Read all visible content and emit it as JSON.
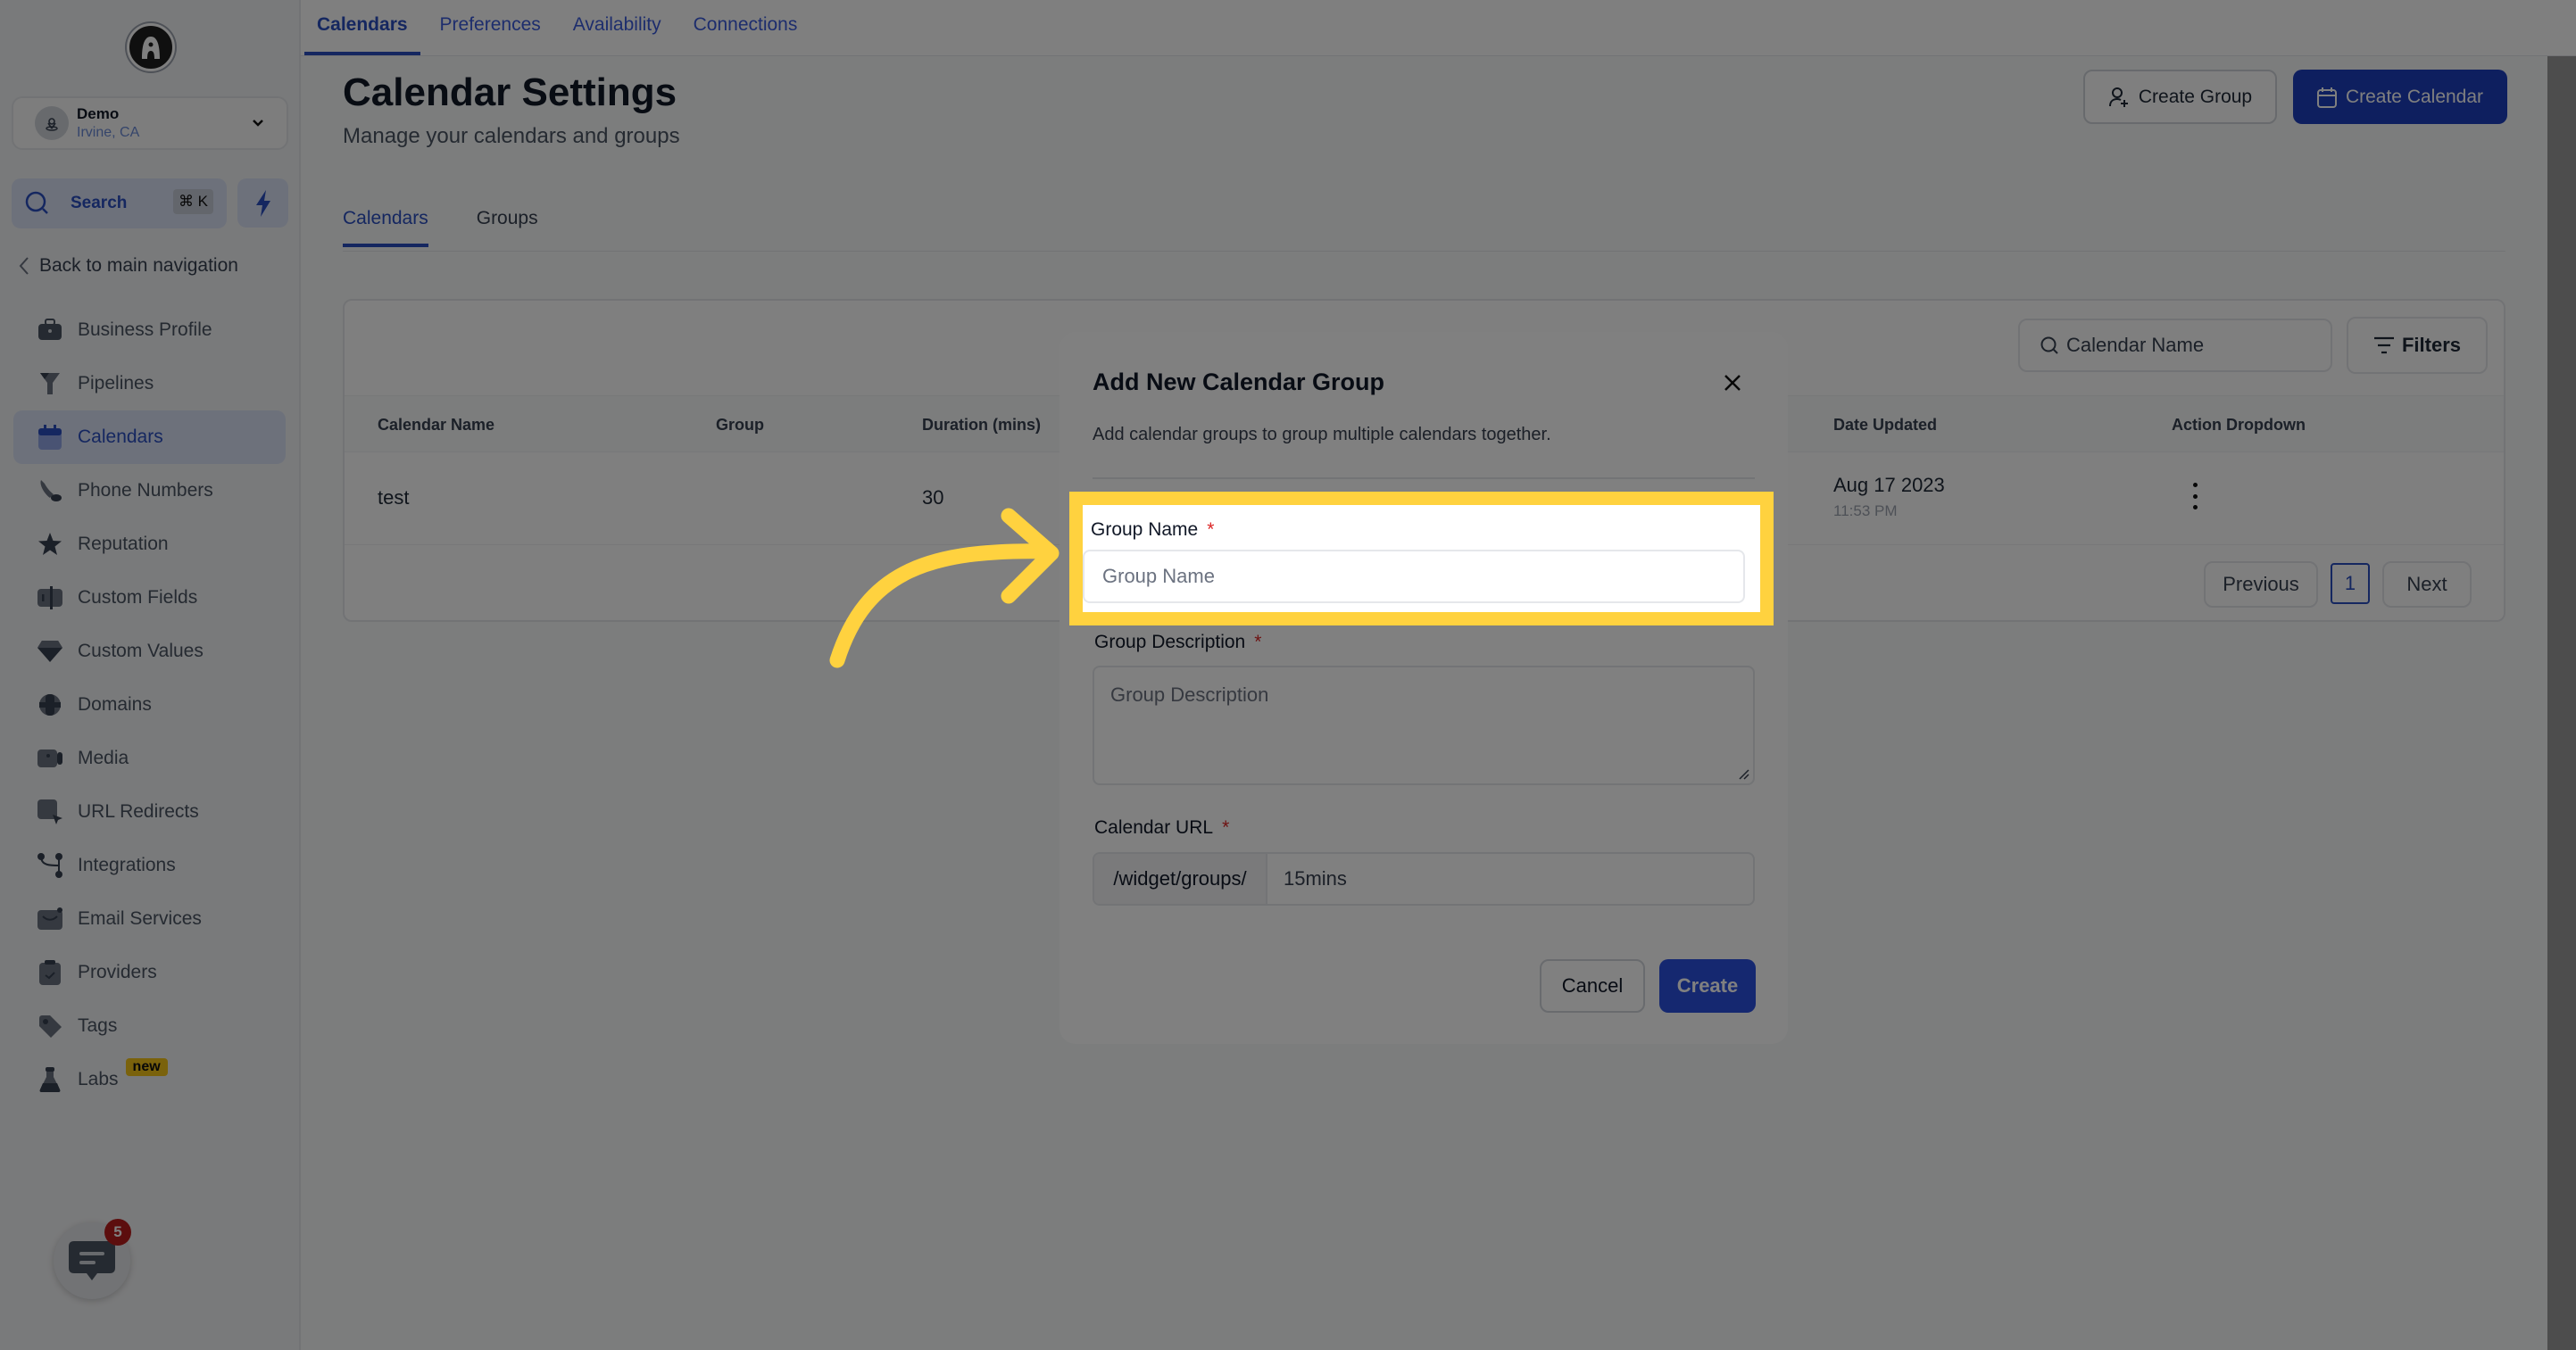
{
  "sidebar": {
    "account": {
      "name": "Demo",
      "location": "Irvine, CA"
    },
    "search": {
      "label": "Search",
      "shortcut": "⌘ K"
    },
    "back_label": "Back to main navigation",
    "items": [
      {
        "label": "Business Profile",
        "icon": "briefcase-icon",
        "active": false
      },
      {
        "label": "Pipelines",
        "icon": "funnel-icon",
        "active": false
      },
      {
        "label": "Calendars",
        "icon": "calendar-icon",
        "active": true
      },
      {
        "label": "Phone Numbers",
        "icon": "phone-icon",
        "active": false
      },
      {
        "label": "Reputation",
        "icon": "star-icon",
        "active": false
      },
      {
        "label": "Custom Fields",
        "icon": "field-icon",
        "active": false
      },
      {
        "label": "Custom Values",
        "icon": "gem-icon",
        "active": false
      },
      {
        "label": "Domains",
        "icon": "globe-icon",
        "active": false
      },
      {
        "label": "Media",
        "icon": "video-icon",
        "active": false
      },
      {
        "label": "URL Redirects",
        "icon": "cursor-icon",
        "active": false
      },
      {
        "label": "Integrations",
        "icon": "branch-icon",
        "active": false
      },
      {
        "label": "Email Services",
        "icon": "mail-icon",
        "active": false
      },
      {
        "label": "Providers",
        "icon": "clipboard-icon",
        "active": false
      },
      {
        "label": "Tags",
        "icon": "tag-icon",
        "active": false
      },
      {
        "label": "Labs",
        "icon": "flask-icon",
        "active": false,
        "badge": "new"
      }
    ],
    "chat_badge_count": "5"
  },
  "topnav": {
    "tabs": [
      {
        "label": "Calendars",
        "active": true
      },
      {
        "label": "Preferences",
        "active": false
      },
      {
        "label": "Availability",
        "active": false
      },
      {
        "label": "Connections",
        "active": false
      }
    ]
  },
  "page": {
    "title": "Calendar Settings",
    "subtitle": "Manage your calendars and groups",
    "create_group_label": "Create Group",
    "create_calendar_label": "Create Calendar",
    "subtabs": [
      {
        "label": "Calendars",
        "active": true
      },
      {
        "label": "Groups",
        "active": false
      }
    ]
  },
  "table": {
    "search_placeholder": "Calendar Name",
    "filters_label": "Filters",
    "columns": [
      "Calendar Name",
      "Group",
      "Duration (mins)",
      "Date Updated",
      "Action Dropdown"
    ],
    "rows": [
      {
        "name": "test",
        "group": "",
        "duration": "30",
        "date": "Aug 17 2023",
        "time": "11:53 PM"
      }
    ],
    "pagination": {
      "previous": "Previous",
      "current_page": "1",
      "next": "Next"
    }
  },
  "modal": {
    "title": "Add New Calendar Group",
    "description": "Add calendar groups to group multiple calendars together.",
    "group_name": {
      "label": "Group Name",
      "required": "*",
      "placeholder": "Group Name",
      "value": ""
    },
    "group_description": {
      "label": "Group Description",
      "required": "*",
      "placeholder": "Group Description",
      "value": ""
    },
    "calendar_url": {
      "label": "Calendar URL",
      "required": "*",
      "prefix": "/widget/groups/",
      "value": "15mins"
    },
    "cancel_label": "Cancel",
    "create_label": "Create"
  },
  "colors": {
    "accent": "#2a4ec0",
    "highlight": "#ffd23f",
    "badge_new": "#f5c518",
    "notification": "#b91c1c"
  }
}
